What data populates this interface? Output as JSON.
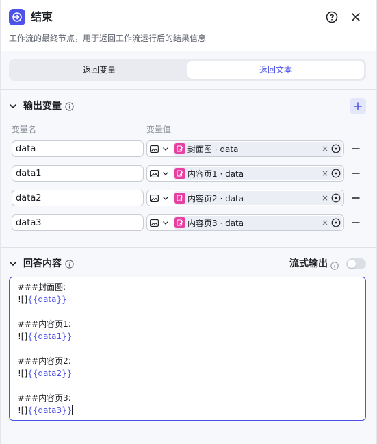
{
  "header": {
    "title": "结束",
    "description": "工作流的最终节点，用于返回工作流运行后的结果信息"
  },
  "tabs": [
    {
      "label": "返回变量",
      "active": false
    },
    {
      "label": "返回文本",
      "active": true
    }
  ],
  "output_section": {
    "title": "输出变量",
    "col_name": "变量名",
    "col_value": "变量值",
    "rows": [
      {
        "name": "data",
        "ref": "封面图 · data"
      },
      {
        "name": "data1",
        "ref": "内容页1 · data"
      },
      {
        "name": "data2",
        "ref": "内容页2 · data"
      },
      {
        "name": "data3",
        "ref": "内容页3 · data"
      }
    ]
  },
  "answer_section": {
    "title": "回答内容",
    "stream_label": "流式输出",
    "stream_enabled": false,
    "content_lines": [
      {
        "text": "###封面图:",
        "var": ""
      },
      {
        "text": "![]",
        "var": "{{data}}"
      },
      {
        "text": "",
        "var": ""
      },
      {
        "text": "###内容页1:",
        "var": ""
      },
      {
        "text": "![]",
        "var": "{{data1}}"
      },
      {
        "text": "",
        "var": ""
      },
      {
        "text": "###内容页2:",
        "var": ""
      },
      {
        "text": "![]",
        "var": "{{data2}}"
      },
      {
        "text": "",
        "var": ""
      },
      {
        "text": "###内容页3:",
        "var": ""
      },
      {
        "text": "![]",
        "var": "{{data3}}"
      }
    ]
  },
  "colors": {
    "accent": "#4d53e8",
    "ref_icon": "#e540a2"
  },
  "icons": {
    "node": "end-node-icon",
    "help": "help-circle-icon",
    "close": "close-icon",
    "add": "plus-icon",
    "type": "image-type-icon",
    "ref": "node-ref-icon",
    "target": "target-icon",
    "remove": "minus-icon",
    "info": "info-icon"
  }
}
